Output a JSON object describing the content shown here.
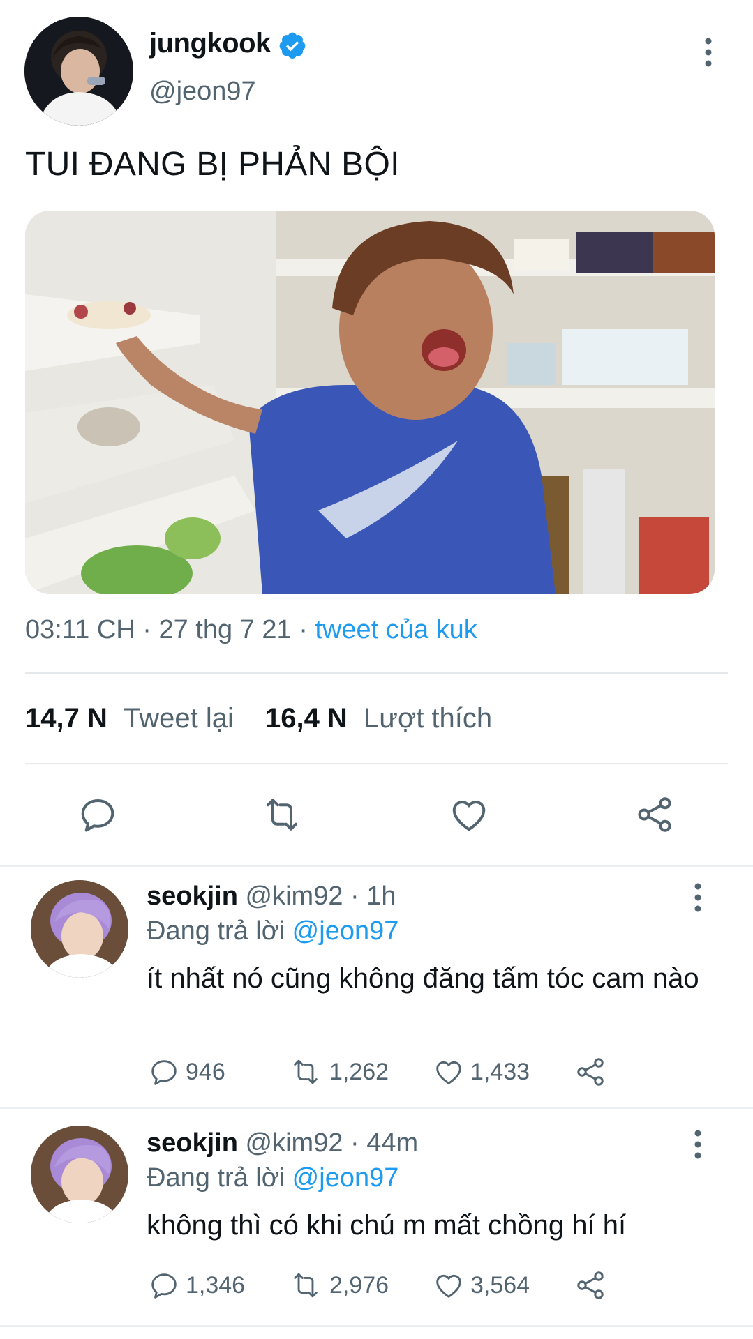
{
  "tweet": {
    "author_name": "jungkook",
    "author_handle": "@jeon97",
    "verified": true,
    "text": "TUI ĐANG BỊ PHẢN BỘI",
    "time_date": "03:11 CH · 27 thg 7 21 · ",
    "source": "tweet của kuk",
    "retweets_count": "14,7 N",
    "retweets_label": "Tweet lại",
    "likes_count": "16,4 N",
    "likes_label": "Lượt thích",
    "actions": [
      "reply-icon",
      "retweet-icon",
      "like-icon",
      "share-icon"
    ]
  },
  "replies": [
    {
      "name": "seokjin",
      "handle_time": "@kim92 · 1h",
      "replying_prefix": "Đang trả lời ",
      "replying_to": "@jeon97",
      "text": "ít nhất nó cũng không đăng tấm tóc cam nào",
      "replies": "946",
      "retweets": "1,262",
      "likes": "1,433"
    },
    {
      "name": "seokjin",
      "handle_time": "@kim92 · 44m",
      "replying_prefix": "Đang trả lời ",
      "replying_to": "@jeon97",
      "text": "không thì có khi chú m mất chồng hí hí",
      "replies": "1,346",
      "retweets": "2,976",
      "likes": "3,564"
    }
  ],
  "colors": {
    "accent": "#1d9bf0",
    "muted": "#536471",
    "text": "#0f1419",
    "divider": "#e6e9ec"
  }
}
